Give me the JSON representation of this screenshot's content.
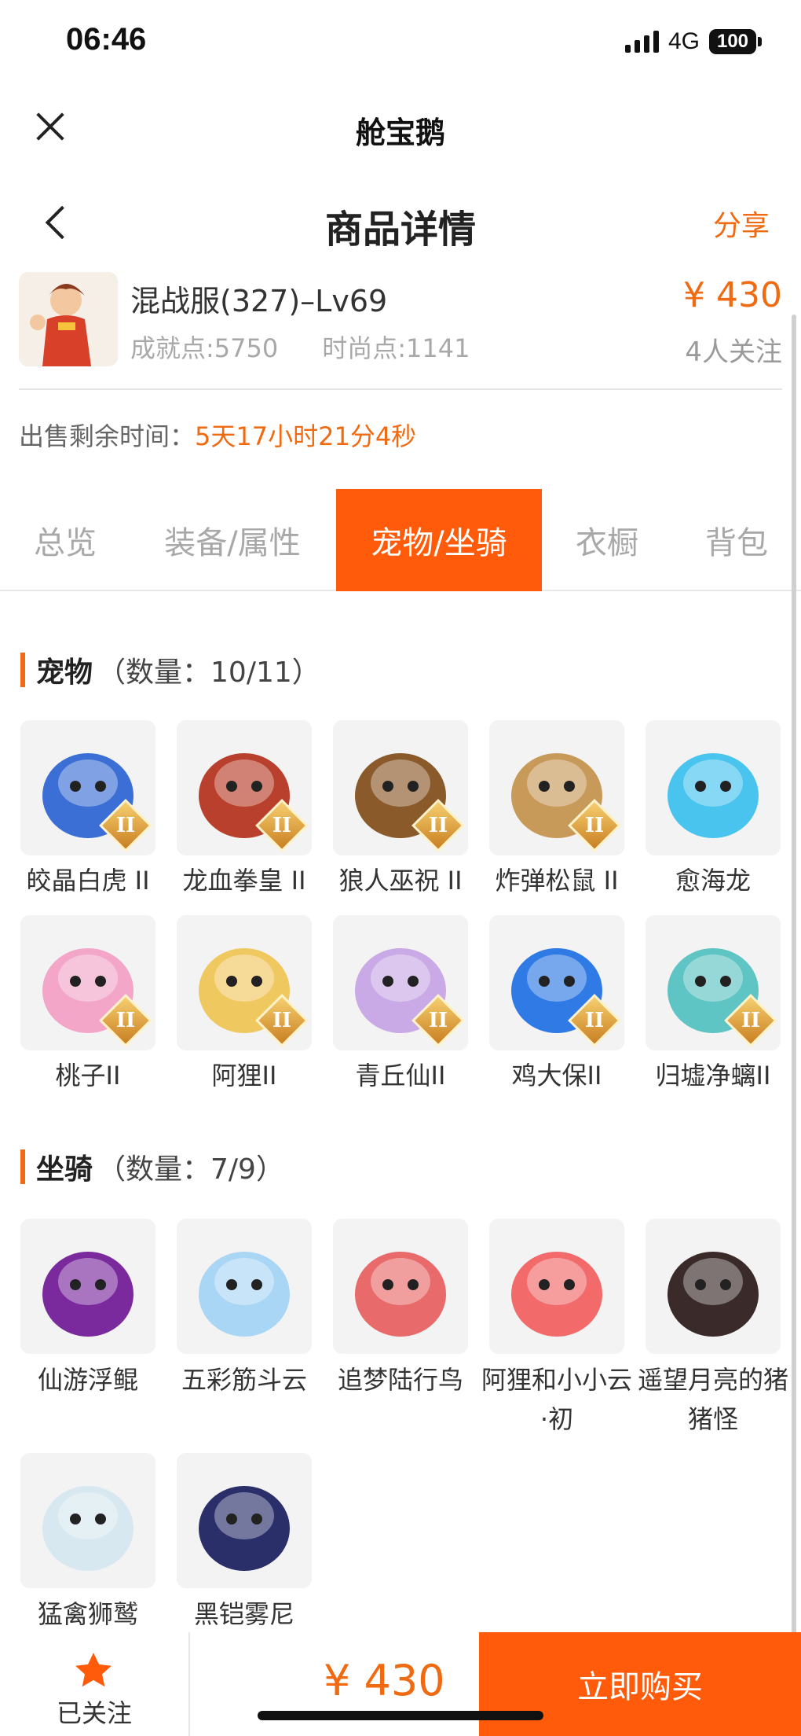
{
  "status_bar": {
    "time": "06:46",
    "network": "4G",
    "battery": "100"
  },
  "mini_program": {
    "title": "舱宝鹅"
  },
  "nav": {
    "title": "商品详情",
    "share": "分享"
  },
  "product": {
    "name": "混战服(327)–Lv69",
    "achievement": "成就点:5750",
    "fashion": "时尚点:1141",
    "price": "¥ 430",
    "followers": "4人关注"
  },
  "sale": {
    "label": "出售剩余时间：",
    "value": "5天17小时21分4秒"
  },
  "tabs": [
    "总览",
    "装备/属性",
    "宠物/坐骑",
    "衣橱",
    "背包"
  ],
  "pets": {
    "title": "宠物",
    "count": "（数量：10/11）",
    "items": [
      {
        "name": "皎晶白虎 II",
        "color": "#3c6fd6",
        "badge": true
      },
      {
        "name": "龙血拳皇 II",
        "color": "#b8402c",
        "badge": true
      },
      {
        "name": "狼人巫祝 II",
        "color": "#8a5a2a",
        "badge": true
      },
      {
        "name": "炸弹松鼠 II",
        "color": "#c89a5a",
        "badge": true
      },
      {
        "name": "愈海龙",
        "color": "#48c4ee",
        "badge": false
      },
      {
        "name": "桃子II",
        "color": "#f3a6c8",
        "badge": true
      },
      {
        "name": "阿狸II",
        "color": "#f0c860",
        "badge": true
      },
      {
        "name": "青丘仙II",
        "color": "#c9a9e6",
        "badge": true
      },
      {
        "name": "鸡大保II",
        "color": "#2f7ae5",
        "badge": true
      },
      {
        "name": "归墟净螭II",
        "color": "#5fc4c4",
        "badge": true
      }
    ]
  },
  "mounts": {
    "title": "坐骑",
    "count": "（数量：7/9）",
    "items": [
      {
        "name": "仙游浮鲲",
        "color": "#7b2a9e"
      },
      {
        "name": "五彩筋斗云",
        "color": "#a9d6f5"
      },
      {
        "name": "追梦陆行鸟",
        "color": "#e86a6a"
      },
      {
        "name": "阿狸和小小云·初",
        "color": "#f26a6a"
      },
      {
        "name": "遥望月亮的猪猪怪",
        "color": "#3a2a2a"
      },
      {
        "name": "猛禽狮鹫",
        "color": "#d8e8f0"
      },
      {
        "name": "黑铠雾尼",
        "color": "#2a2f6a"
      }
    ]
  },
  "bottom": {
    "follow": "已关注",
    "price": "¥ 430",
    "buy": "立即购买"
  },
  "colors": {
    "accent": "#ff5b0a",
    "price": "#f06a12"
  }
}
